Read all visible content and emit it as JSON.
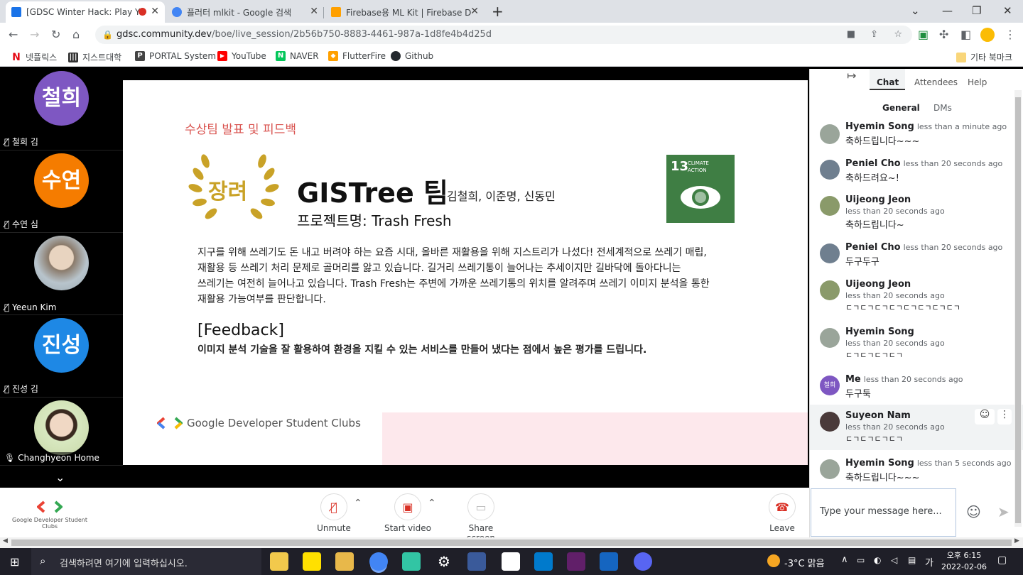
{
  "browser": {
    "tabs": [
      {
        "title": "[GDSC Winter Hack: Play Yo",
        "favicon_color": "#1a73e8"
      },
      {
        "title": "플러터 mlkit - Google 검색",
        "favicon_color": "#4285f4"
      },
      {
        "title": "Firebase용 ML Kit  |  Firebase D",
        "favicon_color": "#ffa000"
      }
    ],
    "new_tab_label": "+",
    "url_host": "gdsc.community.dev",
    "url_path": "/boe/live_session/2b56b750-8883-4461-987a-1d8fe4b4d25d",
    "bookmarks": [
      {
        "label": "넷플릭스",
        "icon": "N",
        "color": "#e50914"
      },
      {
        "label": "지스트대학",
        "icon": "|||",
        "color": "#333333"
      },
      {
        "label": "PORTAL System",
        "icon": "P",
        "color": "#444444"
      },
      {
        "label": "YouTube",
        "icon": "▶",
        "color": "#ff0000"
      },
      {
        "label": "NAVER",
        "icon": "N",
        "color": "#03c75a"
      },
      {
        "label": "FlutterFire",
        "icon": "◆",
        "color": "#ffa000"
      },
      {
        "label": "Github",
        "icon": "●",
        "color": "#24292e"
      }
    ],
    "other_bookmarks": "기타 북마크"
  },
  "participants": [
    {
      "name": "철희 김",
      "avatar_text": "철희",
      "color": "#7e57c2"
    },
    {
      "name": "수연 심",
      "avatar_text": "수연",
      "color": "#f57c00"
    },
    {
      "name": "Yeeun Kim",
      "avatar_text": "",
      "color": "#b0a898"
    },
    {
      "name": "진성 김",
      "avatar_text": "진성",
      "color": "#1e88e5"
    },
    {
      "name": "Changhyeon Home",
      "avatar_text": "",
      "color": "#c8d8a8"
    }
  ],
  "slide": {
    "section_title": "수상팀 발표 및 피드백",
    "award": "장려",
    "team_name": "GISTree 팀",
    "members": "김철희, 이준명, 신동민",
    "project": "프로젝트명: Trash Fresh",
    "sdg_number": "13",
    "sdg_label_1": "CLIMATE",
    "sdg_label_2": "ACTION",
    "body_1": "지구를 위해 쓰레기도 돈 내고 버려야 하는 요즘 시대, 올바른 재활용을 위해 지스트리가 나섰다! 전세계적으로 쓰레기 매립,",
    "body_2": "재활용 등 쓰레기 처리 문제로 골머리를 앓고 있습니다. 길거리 쓰레기통이 늘어나는 추세이지만 길바닥에 돌아다니는",
    "body_3": "쓰레기는 여전히 늘어나고 있습니다. Trash Fresh는 주변에 가까운 쓰레기통의 위치를 알려주며 쓰레기 이미지 분석을 통한",
    "body_4": "재활용 가능여부를 판단합니다.",
    "feedback_title": "[Feedback]",
    "feedback_text": "이미지 분석 기술을 잘 활용하여 환경을 지킬 수 있는 서비스를 만들어 냈다는 점에서 높은 평가를 드립니다.",
    "footer_brand": "Google Developer Student Clubs"
  },
  "chat": {
    "tabs": [
      "Chat",
      "Attendees",
      "Help"
    ],
    "subtabs": [
      "General",
      "DMs"
    ],
    "messages": [
      {
        "name": "Hyemin Song",
        "time": "less than a minute ago",
        "text": "축하드립니다~~~",
        "inline": true,
        "color": "#9aa59a"
      },
      {
        "name": "Peniel Cho",
        "time": "less than 20 seconds ago",
        "text": "축하드려요~!",
        "inline": true,
        "color": "#6f7f8f"
      },
      {
        "name": "Uijeong Jeon",
        "time": "less than 20 seconds ago",
        "text": "축하드립니다~",
        "inline": false,
        "color": "#8a9a6a"
      },
      {
        "name": "Peniel Cho",
        "time": "less than 20 seconds ago",
        "text": "두구두구",
        "inline": true,
        "color": "#6f7f8f"
      },
      {
        "name": "Uijeong Jeon",
        "time": "less than 20 seconds ago",
        "text": "ㄷㄱㄷㄱㄷㄱㄷㄱㄷㄱㄷㄱㄷㄱㄷㄱ",
        "inline": false,
        "color": "#8a9a6a"
      },
      {
        "name": "Hyemin Song",
        "time": "less than 20 seconds ago",
        "text": "ㄷㄱㄷㄱㄷㄱㄷㄱ",
        "inline": false,
        "color": "#9aa59a"
      },
      {
        "name": "Me",
        "time": "less than 20 seconds ago",
        "text": "두구둑",
        "inline": true,
        "color": "#7e57c2",
        "avatar_text": "철희"
      },
      {
        "name": "Suyeon Nam",
        "time": "less than 20 seconds ago",
        "text": "ㄷㄱㄷㄱㄷㄱㄷㄱ",
        "inline": false,
        "color": "#4a3a3a"
      },
      {
        "name": "Hyemin Song",
        "time": "less than 5 seconds ago",
        "text": "축하드립니다~~~",
        "inline": true,
        "color": "#9aa59a"
      }
    ],
    "input_placeholder": "Type your message here..."
  },
  "controls": {
    "logo_text": "Google Developer Student Clubs",
    "unmute": "Unmute",
    "start_video": "Start video",
    "share_screen": "Share screen",
    "leave": "Leave"
  },
  "taskbar": {
    "search_placeholder": "검색하려면 여기에 입력하십시오.",
    "weather": "-3°C 맑음",
    "ime": "가",
    "time_1": "오후 6:15",
    "date": "2022-02-06"
  }
}
